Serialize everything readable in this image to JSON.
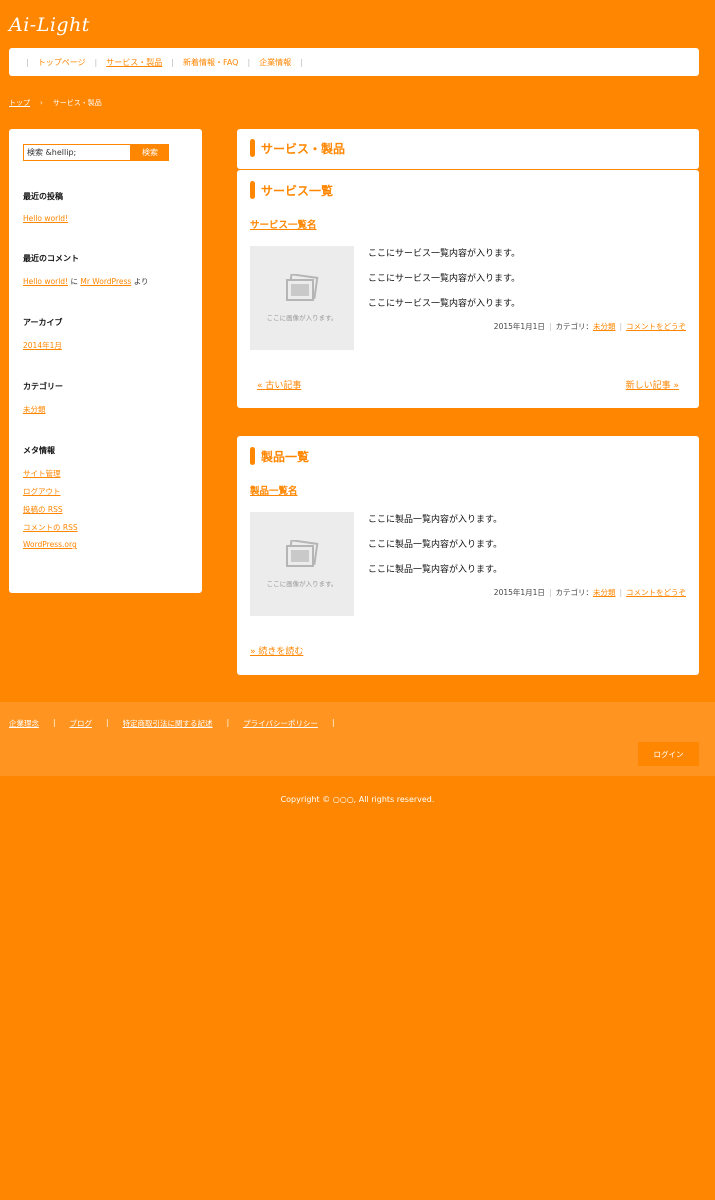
{
  "header": {
    "site_title": "Ai-Light",
    "nav": [
      {
        "label": "トップページ",
        "current": false
      },
      {
        "label": "サービス・製品",
        "current": true
      },
      {
        "label": "新着情報・FAQ",
        "current": false
      },
      {
        "label": "企業情報",
        "current": false
      }
    ]
  },
  "breadcrumb": {
    "home": "トップ",
    "separator": "›",
    "current": "サービス・製品"
  },
  "sidebar": {
    "search": {
      "value": "検索 &hellip;",
      "button": "検索"
    },
    "recent_posts": {
      "title": "最近の投稿",
      "items": [
        "Hello world!"
      ]
    },
    "recent_comments": {
      "title": "最近のコメント",
      "post": "Hello world!",
      "connector": "に",
      "author": "Mr WordPress",
      "suffix": "より"
    },
    "archives": {
      "title": "アーカイブ",
      "items": [
        "2014年1月"
      ]
    },
    "categories": {
      "title": "カテゴリー",
      "items": [
        "未分類"
      ]
    },
    "meta": {
      "title": "メタ情報",
      "items": [
        "サイト管理",
        "ログアウト",
        "投稿の RSS",
        "コメントの RSS",
        "WordPress.org"
      ]
    }
  },
  "main": {
    "page_heading": "サービス・製品",
    "services": {
      "heading": "サービス一覧",
      "post_title": "サービス一覧名",
      "thumb_caption": "ここに画像が入ります。",
      "lines": [
        "ここにサービス一覧内容が入ります。",
        "ここにサービス一覧内容が入ります。",
        "ここにサービス一覧内容が入ります。"
      ],
      "date": "2015年1月1日",
      "category_label": "カテゴリ：",
      "category": "未分類",
      "comment_link": "コメントをどうぞ",
      "older": "« 古い記事",
      "newer": "新しい記事 »"
    },
    "products": {
      "heading": "製品一覧",
      "post_title": "製品一覧名",
      "thumb_caption": "ここに画像が入ります。",
      "lines": [
        "ここに製品一覧内容が入ります。",
        "ここに製品一覧内容が入ります。",
        "ここに製品一覧内容が入ります。"
      ],
      "date": "2015年1月1日",
      "category_label": "カテゴリ：",
      "category": "未分類",
      "comment_link": "コメントをどうぞ",
      "more": "» 続きを読む"
    }
  },
  "footer": {
    "nav": [
      "企業理念",
      "ブログ",
      "特定商取引法に関する記述",
      "プライバシーポリシー"
    ],
    "login": "ログイン",
    "copyright": "Copyright © ○○○, All rights reserved."
  },
  "colors": {
    "brand": "#ff8600",
    "footer_band": "#ff9420",
    "panel": "#ffffff"
  }
}
